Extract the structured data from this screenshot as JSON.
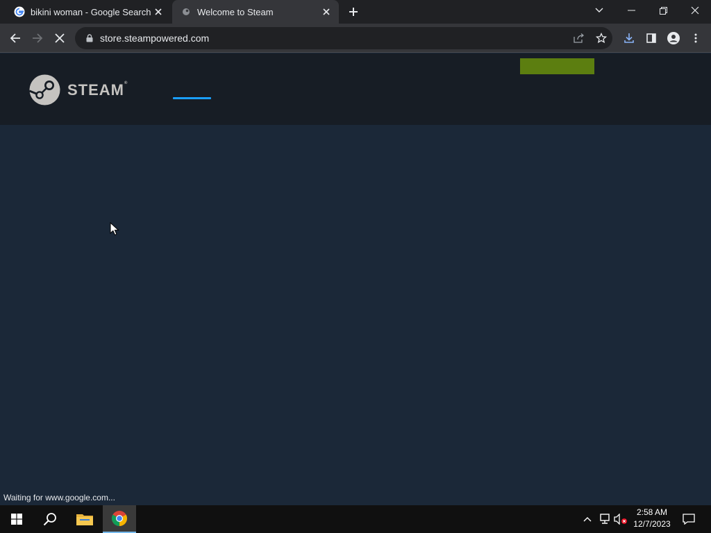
{
  "browser": {
    "tabs": [
      {
        "title": "bikini woman - Google Search",
        "favicon": "google-g-icon",
        "active": false
      },
      {
        "title": "Welcome to Steam",
        "favicon": "steam-icon",
        "active": true
      }
    ],
    "url": "store.steampowered.com",
    "status_text": "Waiting for www.google.com..."
  },
  "steam": {
    "wordmark": "STEAM",
    "registered": "®",
    "install_button_color": "#5c7e10",
    "nav_accent_color": "#1a9fff"
  },
  "taskbar": {
    "time": "2:58 AM",
    "date": "12/7/2023"
  }
}
